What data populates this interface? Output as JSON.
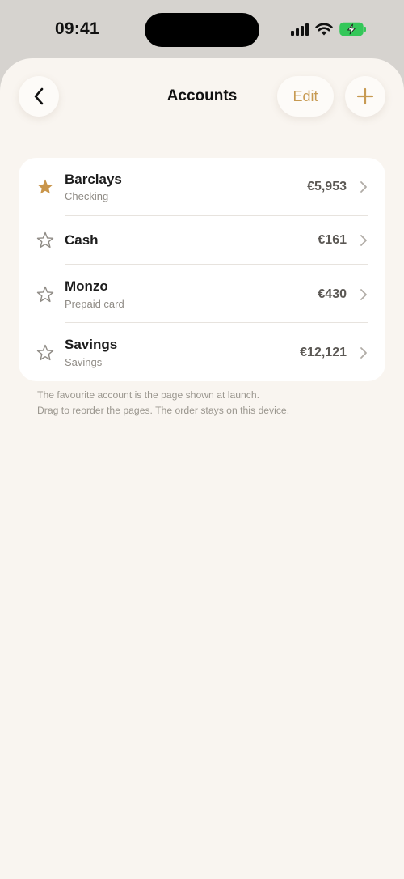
{
  "status_bar": {
    "time": "09:41",
    "icons": [
      "cellular-signal-icon",
      "wifi-icon",
      "battery-charging-icon"
    ]
  },
  "header": {
    "title": "Accounts",
    "edit_label": "Edit",
    "back_icon": "chevron-left-icon",
    "add_icon": "plus-icon"
  },
  "accounts": [
    {
      "name": "Barclays",
      "type": "Checking",
      "balance": "€5,953",
      "favourite": true
    },
    {
      "name": "Cash",
      "type": "",
      "balance": "€161",
      "favourite": false
    },
    {
      "name": "Monzo",
      "type": "Prepaid card",
      "balance": "€430",
      "favourite": false
    },
    {
      "name": "Savings",
      "type": "Savings",
      "balance": "€12,121",
      "favourite": false
    }
  ],
  "footnote": {
    "line1": "The favourite account is the page shown at launch.",
    "line2": "Drag to reorder the pages. The order stays on this device."
  },
  "colors": {
    "accent": "#c79a52",
    "background": "#f9f5f0",
    "card": "#ffffff",
    "star_filled": "#c9954a",
    "star_outline": "#8f8b85"
  }
}
